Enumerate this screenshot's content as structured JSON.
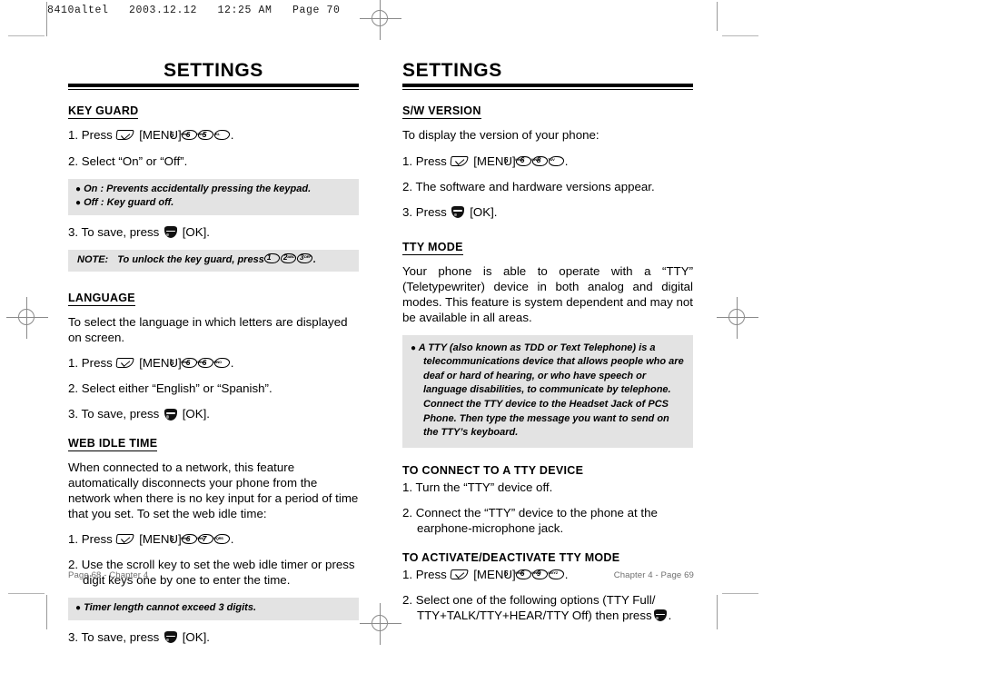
{
  "slug": "8410altel   2003.12.12   12:25 AM   Page 70",
  "left_page": {
    "title": "SETTINGS",
    "footer": "Page 68 - Chapter 4",
    "sections": [
      {
        "heading": "KEY GUARD",
        "step1_pre": "1. Press",
        "step1_mid": "[MENU]",
        "step1_keys": [
          "6",
          "6",
          "5"
        ],
        "step1_post": ".",
        "step2": "2. Select “On” or “Off”.",
        "bullets": [
          "On : Prevents accidentally pressing the keypad.",
          "Off : Key guard off."
        ],
        "step3_pre": "3. To save, press",
        "step3_post": "[OK].",
        "note_label": "NOTE:",
        "note_text": "To unlock the key guard, press",
        "note_keys": [
          "1",
          "2",
          "3"
        ],
        "note_post": "."
      },
      {
        "heading": "LANGUAGE",
        "intro": "To select the language in which letters are displayed on screen.",
        "step1_pre": "1. Press",
        "step1_mid": "[MENU]",
        "step1_keys": [
          "6",
          "6",
          "6"
        ],
        "step1_post": ".",
        "step2": "2. Select either “English” or “Spanish”.",
        "step3_pre": "3. To save, press",
        "step3_post": "[OK]."
      },
      {
        "heading": "WEB IDLE TIME",
        "intro": "When connected to a network, this feature automatically disconnects your phone from the network when there is no key input for a period of time that you set. To set the web idle time:",
        "step1_pre": "1. Press",
        "step1_mid": "[MENU]",
        "step1_keys": [
          "6",
          "6",
          "7"
        ],
        "step1_post": ".",
        "step2": "2. Use the scroll key to set the web idle timer or press digit keys one by one to enter the time.",
        "bullets": [
          "Timer length cannot exceed 3 digits."
        ],
        "step3_pre": "3. To save, press",
        "step3_post": "[OK]."
      }
    ]
  },
  "right_page": {
    "title": "SETTINGS",
    "footer": "Chapter 4 - Page 69",
    "sections": [
      {
        "heading": "S/W VERSION",
        "intro": "To display the version of your phone:",
        "step1_pre": "1. Press",
        "step1_mid": "[MENU]",
        "step1_keys": [
          "6",
          "6",
          "8"
        ],
        "step1_post": ".",
        "step2": "2. The software and hardware versions appear.",
        "step3_pre": "3. Press",
        "step3_post": "[OK]."
      },
      {
        "heading": "TTY MODE",
        "intro": "Your phone is able to operate with a “TTY” (Teletypewriter) device in both analog and digital modes. This feature is system dependent and may not be available in all areas.",
        "bullets": [
          "A TTY (also known as TDD or Text Telephone) is a telecommunications device that allows people who are deaf or hard of hearing, or who have speech or language disabilities, to communicate by telephone. Connect the TTY device to the Headset Jack of PCS Phone. Then type the message you want to send on the TTY’s keyboard."
        ]
      },
      {
        "heading": "TO CONNECT TO A TTY DEVICE",
        "step1": "1. Turn the “TTY” device off.",
        "step2": "2. Connect the “TTY” device to the phone at the earphone-microphone jack."
      },
      {
        "heading": "TO ACTIVATE/DEACTIVATE TTY MODE",
        "step1_pre": "1. Press",
        "step1_mid": "[MENU]",
        "step1_keys": [
          "6",
          "6",
          "9"
        ],
        "step1_post": ".",
        "step2_pre": "2. Select one of the following options (TTY Full/ TTY+TALK/TTY+HEAR/TTY Off) then press",
        "step2_post": "."
      }
    ]
  },
  "icons": {
    "softkey": "menu-softkey-icon",
    "okkey": "ok-button-icon",
    "key_subs": {
      "1": "",
      "2": "ABC",
      "3": "DEF",
      "5": "JKL",
      "6": "MNO",
      "7": "PQRS",
      "8": "TUV",
      "9": "WXYZ"
    }
  },
  "colors": {
    "grey_box": "#e3e3e3",
    "footer_text": "#6f6f6f",
    "mark": "#8a8a8a"
  }
}
